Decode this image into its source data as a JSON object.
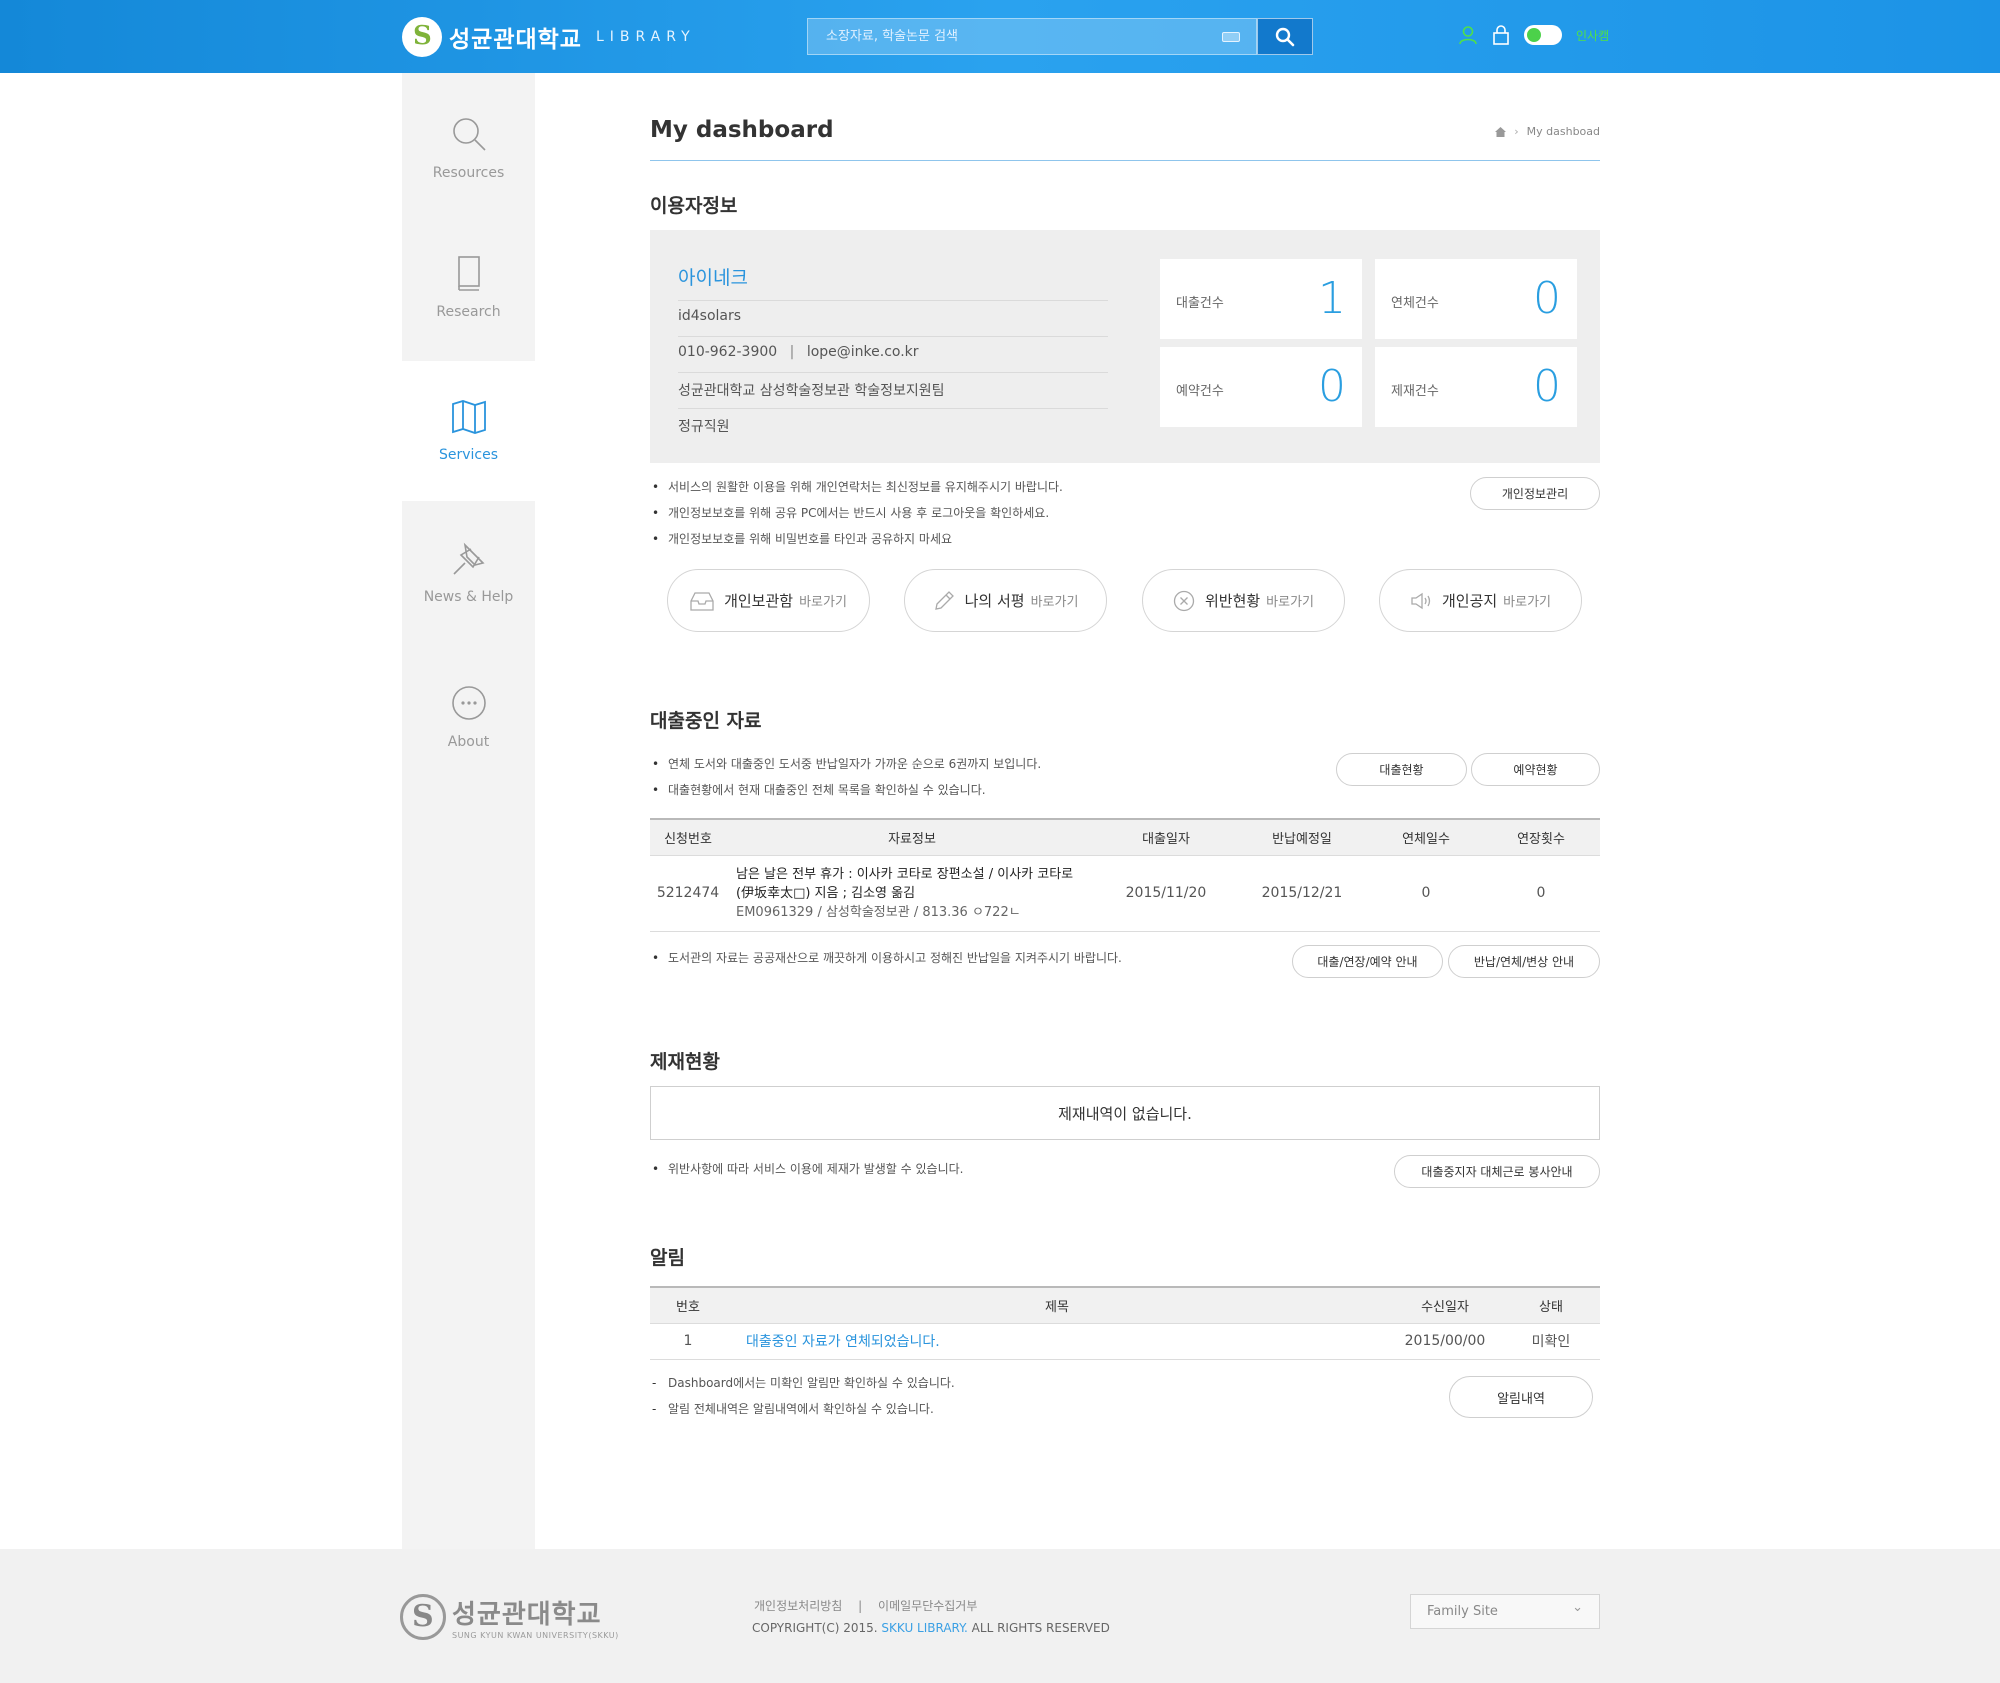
{
  "header": {
    "logo_name": "성균관대학교",
    "logo_sub": "LIBRARY",
    "search_placeholder": "소장자료, 학술논문 검색",
    "login_label": "인사캠"
  },
  "sidebar": {
    "items": [
      {
        "label": "Resources",
        "icon": "search-icon"
      },
      {
        "label": "Research",
        "icon": "book-icon"
      },
      {
        "label": "Services",
        "icon": "map-icon",
        "active": true
      },
      {
        "label": "News & Help",
        "icon": "pin-icon"
      },
      {
        "label": "About",
        "icon": "more-icon"
      }
    ]
  },
  "page": {
    "title": "My dashboard",
    "breadcrumb": "My dashboad"
  },
  "user": {
    "section_title": "이용자정보",
    "name": "아이네크",
    "id": "id4solars",
    "phone": "010-962-3900",
    "email": "lope@inke.co.kr",
    "org": "성균관대학교 삼성학술정보관 학술정보지원팀",
    "type": "정규직원",
    "stats": [
      {
        "label": "대출건수",
        "value": "1"
      },
      {
        "label": "연체건수",
        "value": "0"
      },
      {
        "label": "예약건수",
        "value": "0"
      },
      {
        "label": "제재건수",
        "value": "0"
      }
    ],
    "notes": [
      "서비스의 원활한 이용을 위해 개인연락처는 최신정보를 유지해주시기 바랍니다.",
      "개인정보보호를 위해 공유 PC에서는 반드시 사용 후 로그아웃을 확인하세요.",
      "개인정보보호를 위해 비밀번호를 타인과 공유하지 마세요"
    ],
    "manage_button": "개인정보관리"
  },
  "quick_links": [
    {
      "title": "개인보관함",
      "sub": "바로가기",
      "icon": "inbox-icon"
    },
    {
      "title": "나의 서평",
      "sub": "바로가기",
      "icon": "pencil-icon"
    },
    {
      "title": "위반현황",
      "sub": "바로가기",
      "icon": "circle-x-icon"
    },
    {
      "title": "개인공지",
      "sub": "바로가기",
      "icon": "speaker-icon"
    }
  ],
  "loans": {
    "section_title": "대출중인 자료",
    "notes": [
      "연체 도서와 대출중인 도서중 반납일자가 가까운 순으로 6권까지 보입니다.",
      "대출현황에서 현재 대출중인 전체 목록을 확인하실 수 있습니다."
    ],
    "btn_status": "대출현황",
    "btn_reserve": "예약현황",
    "columns": [
      "신청번호",
      "자료정보",
      "대출일자",
      "반납예정일",
      "연체일수",
      "연장횟수"
    ],
    "rows": [
      {
        "no": "5212474",
        "title_line1": "남은 날은 전부 휴가 : 이사카 코타로 장편소설 / 이사카 코타로",
        "title_line2": "(伊坂幸太□) 지음 ; 김소영 옮김",
        "callno": "EM0961329 / 삼성학술정보관 / 813.36 ㅇ722ㄴ",
        "loan_date": "2015/11/20",
        "due_date": "2015/12/21",
        "overdue": "0",
        "renewals": "0"
      }
    ],
    "footnote": "도서관의 자료는 공공재산으로 깨끗하게 이용하시고 정해진 반납일을 지켜주시기 바랍니다.",
    "btn_guide1": "대출/연장/예약 안내",
    "btn_guide2": "반납/연체/변상 안내"
  },
  "penalty": {
    "section_title": "제재현황",
    "empty": "제재내역이 없습니다.",
    "note": "위반사항에 따라 서비스 이용에 제재가 발생할 수 있습니다.",
    "button": "대출중지자 대체근로 봉사안내"
  },
  "alerts": {
    "section_title": "알림",
    "columns": [
      "번호",
      "제목",
      "수신일자",
      "상태"
    ],
    "rows": [
      {
        "no": "1",
        "title": "대출중인 자료가 연체되었습니다.",
        "date": "2015/00/00",
        "status": "미확인"
      }
    ],
    "notes": [
      "Dashboard에서는 미확인 알림만 확인하실 수 있습니다.",
      "알림 전체내역은 알림내역에서 확인하실 수 있습니다."
    ],
    "button": "알림내역"
  },
  "footer": {
    "logo_name": "성균관대학교",
    "logo_sub": "SUNG KYUN KWAN UNIVERSITY(SKKU)",
    "link1": "개인정보처리방침",
    "separator": "|",
    "link2": "이메일무단수집거부",
    "copyright_pre": "COPYRIGHT(C) 2015.",
    "copyright_hl": "SKKU LIBRARY.",
    "copyright_post": "ALL RIGHTS RESERVED",
    "family_site": "Family Site"
  },
  "colors": {
    "header_blue": "#1c93e6",
    "accent_blue": "#2a94dd",
    "toggle_green": "#4cd14a"
  }
}
